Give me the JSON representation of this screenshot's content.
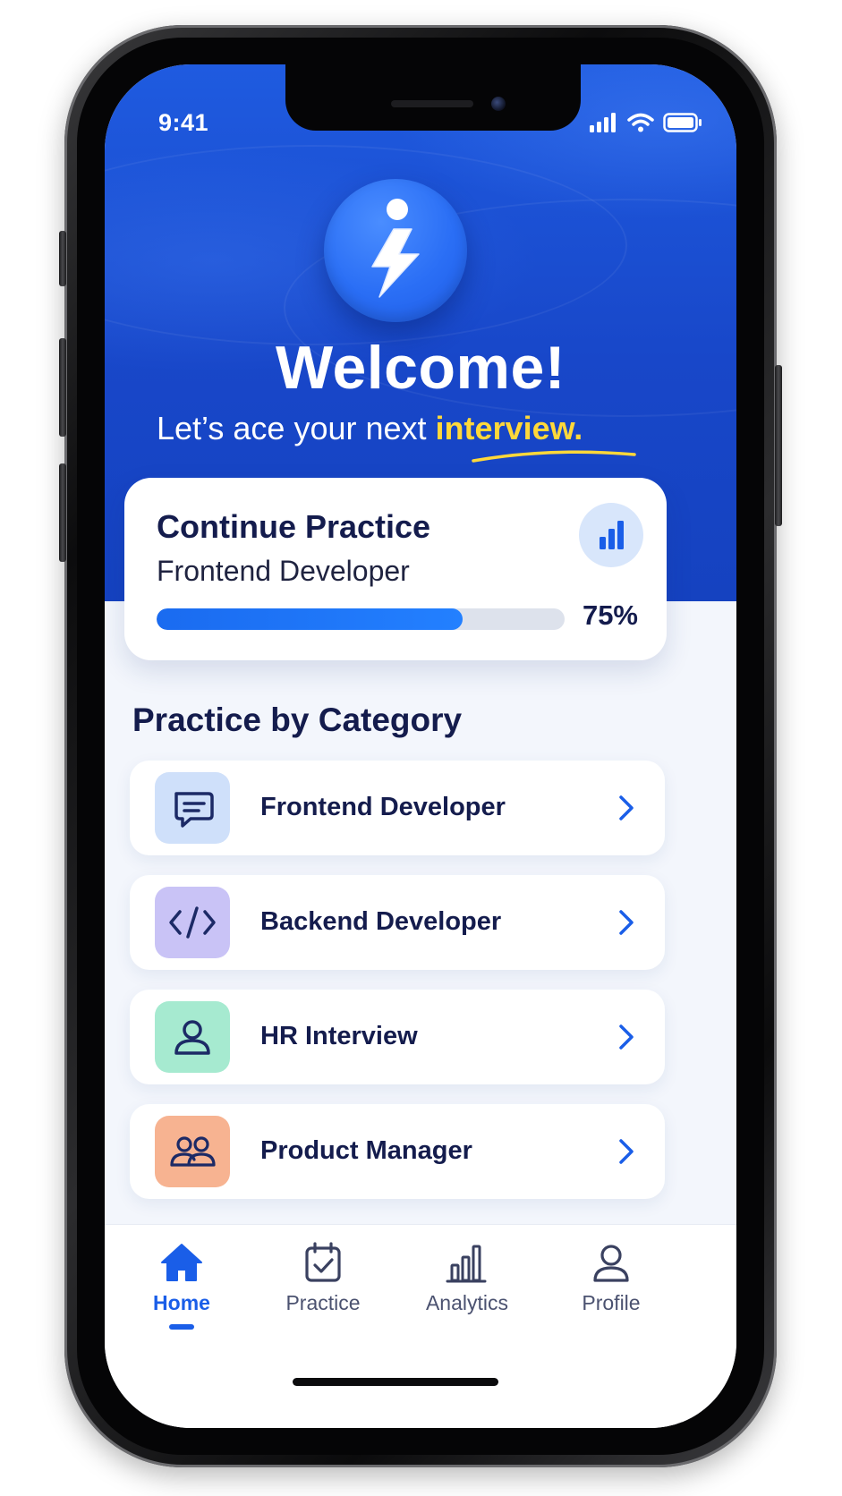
{
  "status_bar": {
    "time": "9:41",
    "icons": [
      "cellular-signal-icon",
      "wifi-icon",
      "battery-icon"
    ]
  },
  "hero": {
    "logo_icon": "lightning-person-icon",
    "title": "Welcome!",
    "tagline_prefix": "Let’s ace your next ",
    "tagline_highlight": "interview."
  },
  "continue_card": {
    "title": "Continue Practice",
    "subtitle": "Frontend Developer",
    "progress_percent": 75,
    "progress_label": "75%",
    "icon": "bar-chart-icon"
  },
  "categories": {
    "title": "Practice by Category",
    "items": [
      {
        "label": "Frontend Developer",
        "icon": "chat-bubble-icon",
        "icon_bg": "#cfe0fa",
        "icon_color": "#1c2a66"
      },
      {
        "label": "Backend Developer",
        "icon": "code-icon",
        "icon_bg": "#c9c3f6",
        "icon_color": "#1c2a66"
      },
      {
        "label": "HR Interview",
        "icon": "person-icon",
        "icon_bg": "#a6ead0",
        "icon_color": "#1c2a66"
      },
      {
        "label": "Product Manager",
        "icon": "team-icon",
        "icon_bg": "#f7b391",
        "icon_color": "#1c2a66"
      }
    ]
  },
  "bottom_nav": {
    "items": [
      {
        "label": "Home",
        "icon": "home-icon",
        "active": true
      },
      {
        "label": "Practice",
        "icon": "calendar-check-icon",
        "active": false
      },
      {
        "label": "Analytics",
        "icon": "analytics-icon",
        "active": false
      },
      {
        "label": "Profile",
        "icon": "profile-icon",
        "active": false
      }
    ]
  },
  "colors": {
    "header_blue": "#1c50d6",
    "accent_blue": "#1a6bf0",
    "highlight_yellow": "#ffd83a",
    "text_dark": "#141c4d",
    "background": "#f3f6fc"
  }
}
